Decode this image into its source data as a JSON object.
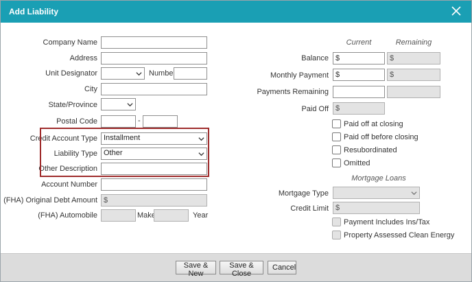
{
  "dialog": {
    "title": "Add Liability"
  },
  "left": {
    "company_name": {
      "label": "Company Name",
      "value": ""
    },
    "address": {
      "label": "Address",
      "value": ""
    },
    "unit_designator": {
      "label": "Unit Designator",
      "value": ""
    },
    "number": {
      "label": "Number",
      "value": ""
    },
    "city": {
      "label": "City",
      "value": ""
    },
    "state": {
      "label": "State/Province",
      "value": ""
    },
    "postal_code": {
      "label": "Postal Code",
      "value1": "",
      "dash": "-",
      "value2": ""
    },
    "credit_account_type": {
      "label": "Credit Account Type",
      "value": "Installment"
    },
    "liability_type": {
      "label": "Liability Type",
      "value": "Other"
    },
    "other_description": {
      "label": "Other Description",
      "value": ""
    },
    "account_number": {
      "label": "Account Number",
      "value": ""
    },
    "original_debt": {
      "label": "(FHA) Original Debt Amount",
      "value": "$"
    },
    "automobile": {
      "label": "(FHA) Automobile",
      "make_label": "Make",
      "year_label": "Year"
    }
  },
  "right": {
    "col_current": "Current",
    "col_remaining": "Remaining",
    "balance": {
      "label": "Balance",
      "current": "$",
      "remaining": "$"
    },
    "monthly_payment": {
      "label": "Monthly Payment",
      "current": "$",
      "remaining": "$"
    },
    "payments_remaining": {
      "label": "Payments Remaining",
      "current": "",
      "remaining": ""
    },
    "paid_off": {
      "label": "Paid Off",
      "value": "$"
    },
    "checks": {
      "paid_at_closing": "Paid off at closing",
      "paid_before_closing": "Paid off before closing",
      "resubordinated": "Resubordinated",
      "omitted": "Omitted"
    },
    "mortgage_header": "Mortgage Loans",
    "mortgage_type": {
      "label": "Mortgage Type",
      "value": ""
    },
    "credit_limit": {
      "label": "Credit Limit",
      "value": "$"
    },
    "payment_includes": "Payment Includes Ins/Tax",
    "pace": "Property Assessed Clean Energy"
  },
  "footer": {
    "save_new": "Save & New",
    "save_close": "Save & Close",
    "cancel": "Cancel"
  },
  "colors": {
    "titlebar": "#1a9fb4",
    "highlight": "#9e2a2a",
    "footer": "#dcdcdc"
  }
}
